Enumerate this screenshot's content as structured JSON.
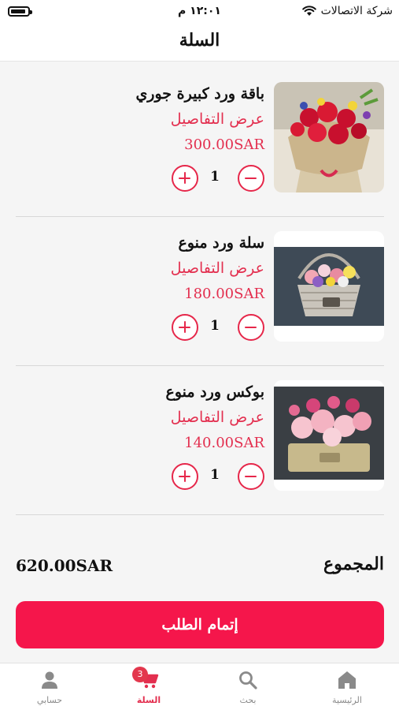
{
  "status_bar": {
    "time": "١٢:٠١ م",
    "carrier": "شركة الاتصالات"
  },
  "header": {
    "title": "السلة"
  },
  "cart": {
    "items": [
      {
        "name": "باقة ورد كبيرة جوري",
        "details_link": "عرض التفاصيل",
        "price": "300.00SAR",
        "quantity": "1",
        "image": "red-roses-bouquet"
      },
      {
        "name": "سلة ورد منوع",
        "details_link": "عرض التفاصيل",
        "price": "180.00SAR",
        "quantity": "1",
        "image": "mixed-flower-basket"
      },
      {
        "name": "بوكس ورد منوع",
        "details_link": "عرض التفاصيل",
        "price": "140.00SAR",
        "quantity": "1",
        "image": "pink-roses-box"
      }
    ]
  },
  "summary": {
    "total_label": "المجموع",
    "total_value": "620.00SAR"
  },
  "checkout": {
    "label": "إتمام الطلب"
  },
  "tabbar": {
    "tabs": [
      {
        "label": "حسابي",
        "icon": "person-icon"
      },
      {
        "label": "السلة",
        "icon": "cart-icon",
        "active": true,
        "badge": "3"
      },
      {
        "label": "بحث",
        "icon": "search-icon"
      },
      {
        "label": "الرئيسية",
        "icon": "home-icon"
      }
    ]
  },
  "colors": {
    "accent": "#f5164b",
    "link": "#e32f4f",
    "background": "#f5f5f5"
  }
}
